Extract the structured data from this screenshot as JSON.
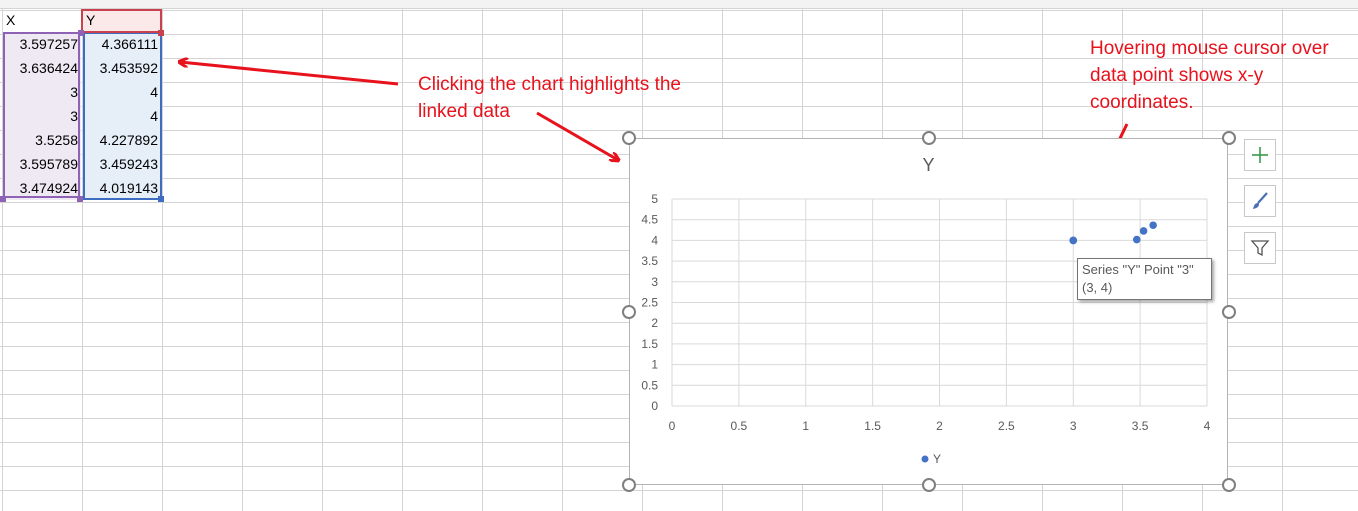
{
  "sheet": {
    "headers": {
      "x": "X",
      "y": "Y"
    },
    "rows": [
      {
        "x": "3.597257",
        "y": "4.366111"
      },
      {
        "x": "3.636424",
        "y": "3.453592"
      },
      {
        "x": "3",
        "y": "4"
      },
      {
        "x": "3",
        "y": "4"
      },
      {
        "x": "3.5258",
        "y": "4.227892"
      },
      {
        "x": "3.595789",
        "y": "3.459243"
      },
      {
        "x": "3.474924",
        "y": "4.019143"
      }
    ]
  },
  "annotations": {
    "click_note": "Clicking the chart highlights the linked data",
    "hover_note": "Hovering mouse cursor over data point shows x-y coordinates."
  },
  "tooltip": {
    "line1": "Series \"Y\" Point \"3\"",
    "line2": "(3, 4)"
  },
  "side_buttons": {
    "elements": "plus-icon",
    "styles": "paintbrush-icon",
    "filters": "funnel-icon"
  },
  "colors": {
    "marker": "#4472c4",
    "annotation": "#e8121c"
  },
  "chart_data": {
    "type": "scatter",
    "title": "Y",
    "xlabel": "",
    "ylabel": "",
    "xlim": [
      0,
      4
    ],
    "ylim": [
      0,
      5
    ],
    "x_ticks": [
      "0",
      "0.5",
      "1",
      "1.5",
      "2",
      "2.5",
      "3",
      "3.5",
      "4"
    ],
    "y_ticks": [
      "0",
      "0.5",
      "1",
      "1.5",
      "2",
      "2.5",
      "3",
      "3.5",
      "4",
      "4.5",
      "5"
    ],
    "grid": true,
    "legend": "bottom",
    "series": [
      {
        "name": "Y",
        "points": [
          [
            3.597257,
            4.366111
          ],
          [
            3.636424,
            3.453592
          ],
          [
            3,
            4
          ],
          [
            3,
            4
          ],
          [
            3.5258,
            4.227892
          ],
          [
            3.595789,
            3.459243
          ],
          [
            3.474924,
            4.019143
          ]
        ]
      }
    ]
  }
}
